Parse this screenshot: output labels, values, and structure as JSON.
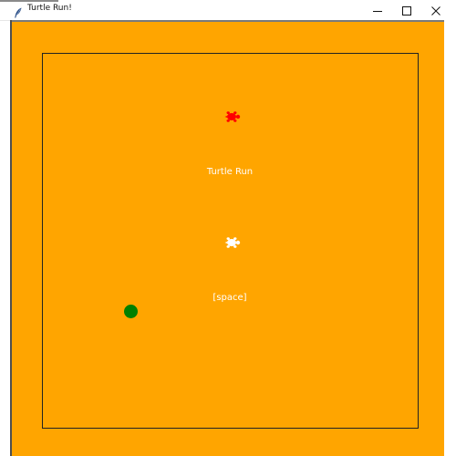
{
  "window": {
    "title": "Turtle Run!"
  },
  "titlebar_icons": {
    "app": "feather-icon",
    "minimize": "minimize-icon",
    "maximize": "maximize-icon",
    "close": "close-icon"
  },
  "game": {
    "title_text": "Turtle Run",
    "prompt_text": "[space]",
    "background_color": "#ffa500",
    "border_color": "#222222",
    "enemy_turtle_color": "#ff0000",
    "player_turtle_color": "#ffffff",
    "ball_color": "#008000"
  }
}
